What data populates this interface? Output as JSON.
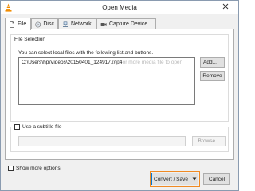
{
  "window": {
    "title": "Open Media",
    "app_icon": "vlc-cone-icon",
    "close_icon": "close-icon"
  },
  "tabs": [
    {
      "label": "File",
      "icon": "file-icon",
      "active": true
    },
    {
      "label": "Disc",
      "icon": "disc-icon",
      "active": false
    },
    {
      "label": "Network",
      "icon": "network-icon",
      "active": false
    },
    {
      "label": "Capture Device",
      "icon": "capture-device-icon",
      "active": false
    }
  ],
  "file_selection": {
    "group_title": "File Selection",
    "description": "You can select local files with the following list and buttons.",
    "files": [
      "C:\\Users\\hp\\Videos\\20150401_124917.mp4"
    ],
    "ghost_tooltip": "one or more media file to open",
    "add_label": "Add...",
    "remove_label": "Remove"
  },
  "subtitle": {
    "checkbox_label": "Use a subtitle file",
    "checked": false,
    "path_value": "",
    "browse_label": "Browse..."
  },
  "footer": {
    "show_more_label": "Show more options",
    "convert_label": "Convert / Save",
    "cancel_label": "Cancel"
  },
  "colors": {
    "accent_focus": "#0078d7",
    "highlight_outline": "#f08a24",
    "vlc_orange": "#f28c00"
  }
}
